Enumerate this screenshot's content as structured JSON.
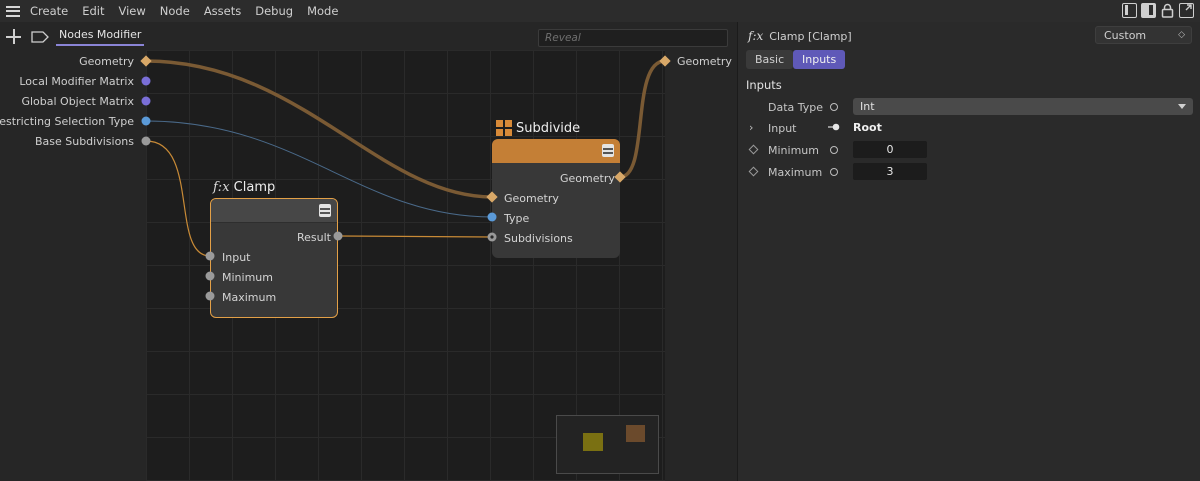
{
  "menubar": {
    "items": [
      "Create",
      "Edit",
      "View",
      "Node",
      "Assets",
      "Debug",
      "Mode"
    ]
  },
  "node_editor": {
    "tab_label": "Nodes Modifier",
    "reveal_placeholder": "Reveal",
    "input_ports": [
      "Geometry",
      "Local Modifier Matrix",
      "Global Object Matrix",
      "Restricting Selection Type",
      "Base Subdivisions"
    ],
    "output_port": "Geometry",
    "colors": {
      "geometry_wire": "#7a5a34",
      "type_wire": "#4a6a8a",
      "int_wire": "#c88a36",
      "matrix_port": "#7a6fd8",
      "type_port": "#5b9ad8",
      "int_port": "#9a9a9a",
      "geometry_port": "#d8a868"
    }
  },
  "nodes": {
    "clamp": {
      "title": "Clamp",
      "icon": "fx-icon",
      "output": "Result",
      "inputs": [
        "Input",
        "Minimum",
        "Maximum"
      ]
    },
    "subdivide": {
      "title": "Subdivide",
      "icon": "grid-icon",
      "output": "Geometry",
      "inputs": [
        "Geometry",
        "Type",
        "Subdivisions"
      ]
    }
  },
  "attributes": {
    "title": "Clamp [Clamp]",
    "preset": "Custom",
    "tabs": [
      "Basic",
      "Inputs"
    ],
    "active_tab": "Inputs",
    "section": "Inputs",
    "rows": {
      "data_type": {
        "label": "Data Type",
        "value": "Int"
      },
      "input": {
        "label": "Input",
        "value": "Root"
      },
      "minimum": {
        "label": "Minimum",
        "value": "0"
      },
      "maximum": {
        "label": "Maximum",
        "value": "3"
      }
    }
  }
}
